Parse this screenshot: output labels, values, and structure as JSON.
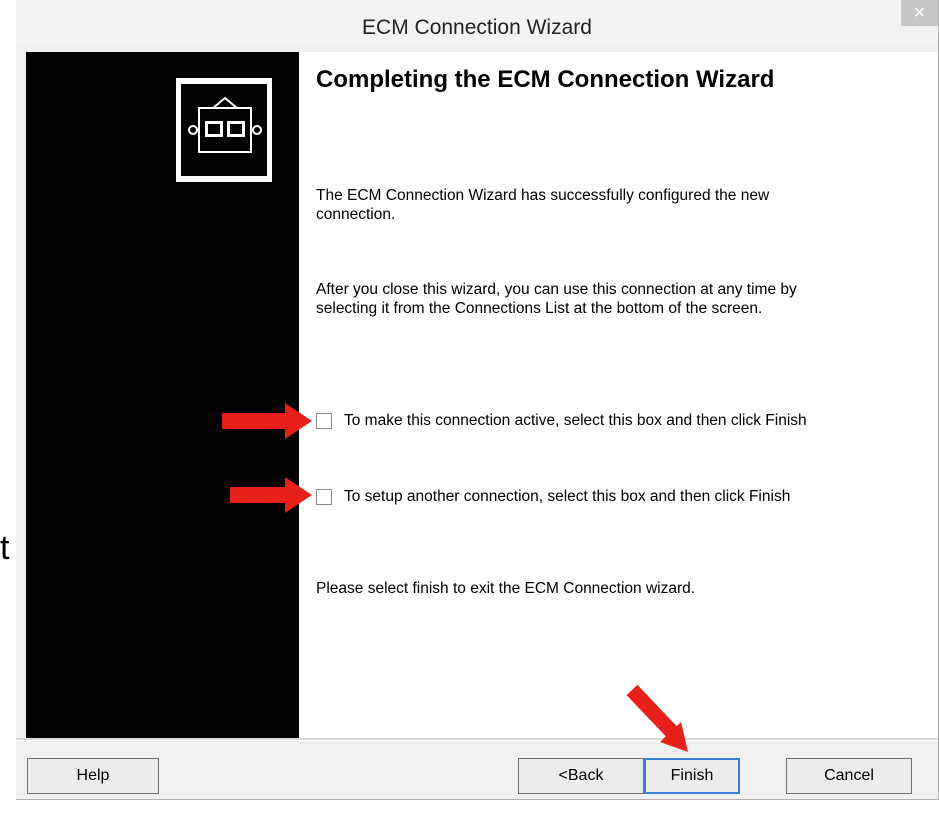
{
  "background": {
    "glyph": "t"
  },
  "window": {
    "title": "ECM Connection Wizard",
    "close_label": "×"
  },
  "wizard": {
    "heading": "Completing the ECM Connection Wizard",
    "paragraph_1": "The ECM Connection Wizard has successfully configured the new connection.",
    "paragraph_2": "After you close this wizard, you can use this connection at any time by selecting it from the Connections List at the bottom of the screen.",
    "checkbox_active": {
      "label": "To make this connection active, select this box and then click Finish",
      "checked": false
    },
    "checkbox_another": {
      "label": "To setup another connection, select this box and then click Finish",
      "checked": false
    },
    "paragraph_3": "Please select finish to exit the ECM Connection wizard."
  },
  "buttons": {
    "help": "Help",
    "back": "<Back",
    "finish": "Finish",
    "cancel": "Cancel"
  },
  "colors": {
    "sidebar": "#000000",
    "dialog_bg": "#f0f0f0",
    "annotation_arrow": "#e8201a",
    "default_button_border": "#3b7dd8"
  },
  "icons": {
    "wizard_logo": "ecm-connector-icon",
    "annotation": "red-arrow-icon"
  }
}
